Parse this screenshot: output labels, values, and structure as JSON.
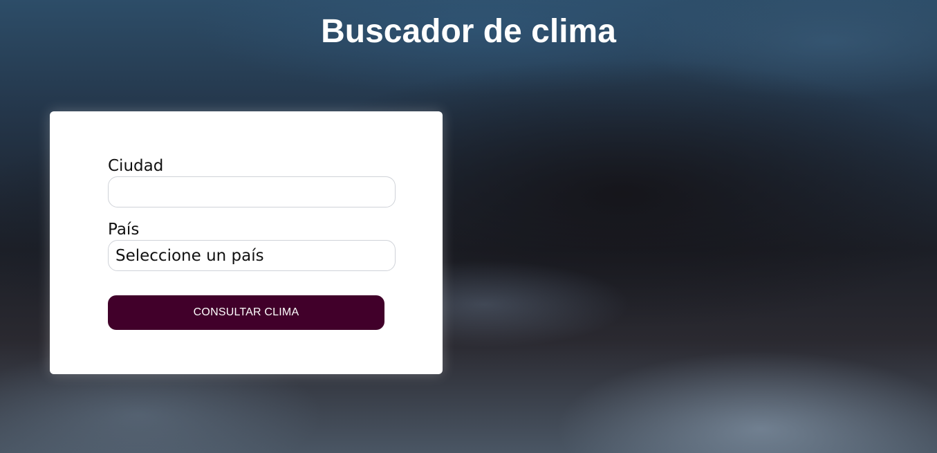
{
  "page": {
    "title": "Buscador de clima"
  },
  "form": {
    "city_label": "Ciudad",
    "city_value": "",
    "country_label": "País",
    "country_selected": "Seleccione un país",
    "submit_label": "CONSULTAR CLIMA"
  },
  "colors": {
    "button_bg": "#41002a",
    "title_text": "#ffffff",
    "card_bg": "#ffffff"
  }
}
